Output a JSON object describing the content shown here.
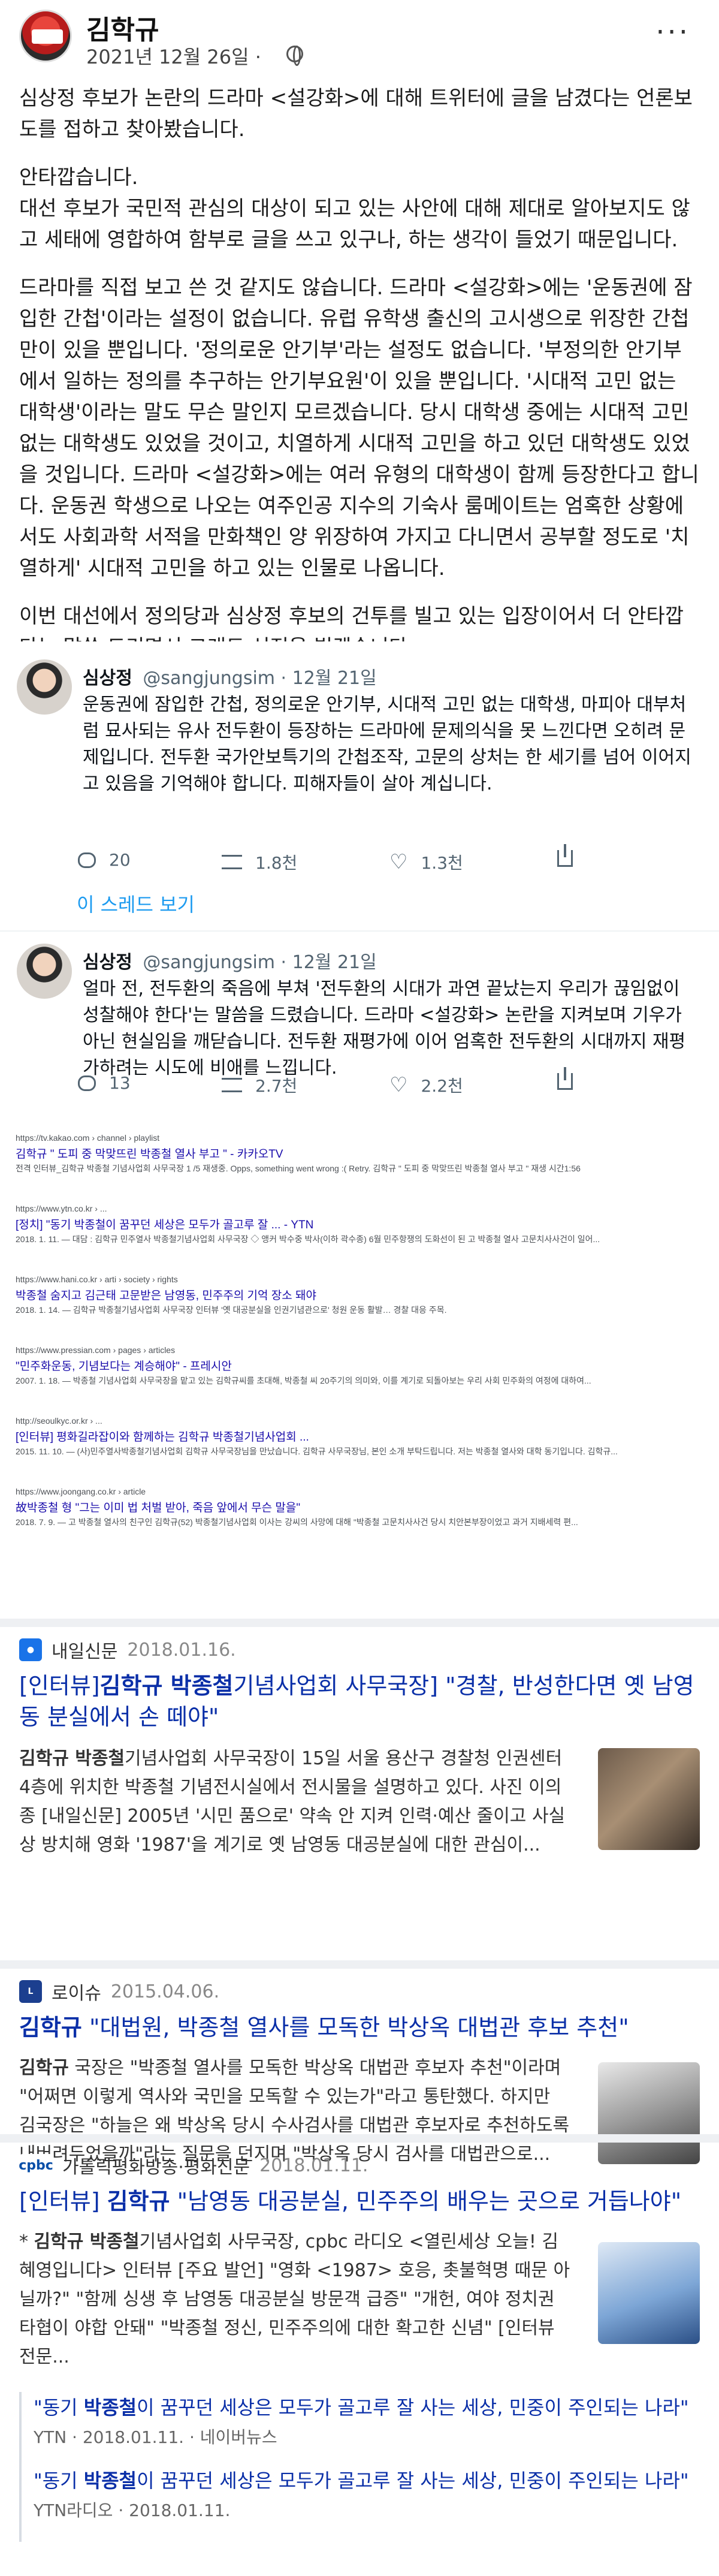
{
  "post": {
    "author": "김학규",
    "date": "2021년 12월 26일 ·",
    "paragraphs": [
      "심상정 후보가 논란의 드라마 <설강화>에 대해 트위터에 글을 남겼다는 언론보도를 접하고 찾아봤습니다.",
      "안타깝습니다.\n대선 후보가 국민적 관심의 대상이 되고 있는 사안에 대해 제대로 알아보지도 않고 세태에 영합하여 함부로 글을 쓰고 있구나, 하는 생각이 들었기 때문입니다.",
      "드라마를 직접 보고 쓴 것 같지도 않습니다. 드라마 <설강화>에는 '운동권에 잠입한 간첩'이라는 설정이 없습니다. 유럽 유학생 출신의 고시생으로 위장한 간첩만이 있을 뿐입니다. '정의로운 안기부'라는 설정도 없습니다. '부정의한 안기부에서 일하는 정의를 추구하는 안기부요원'이 있을 뿐입니다. '시대적 고민 없는 대학생'이라는 말도 무슨 말인지 모르겠습니다. 당시 대학생 중에는 시대적 고민 없는 대학생도 있었을 것이고, 치열하게 시대적 고민을 하고 있던 대학생도 있었을 것입니다. 드라마 <설강화>에는 여러 유형의 대학생이 함께 등장한다고 합니다. 운동권 학생으로 나오는 여주인공 지수의 기숙사 룸메이트는 엄혹한 상황에서도 사회과학 서적을 만화책인 양 위장하여 가지고 다니면서 공부할 정도로 '치열하게' 시대적 고민을 하고 있는 인물로 나옵니다.",
      "이번 대선에서 정의당과 심상정 후보의 건투를 빌고 있는 입장이어서 더 안타깝다는 말씀 드리면서 그래도 선전을 빌겠습니다."
    ]
  },
  "tweets": [
    {
      "name": "심상정",
      "handle": "@sangjungsim · 12월 21일",
      "text": "운동권에 잠입한 간첩, 정의로운 안기부, 시대적 고민 없는 대학생, 마피아 대부처럼 묘사되는 유사 전두환이 등장하는 드라마에 문제의식을 못 느낀다면 오히려 문제입니다. 전두환 국가안보특기의 간첩조작, 고문의 상처는 한 세기를 넘어 이어지고 있음을 기억해야 합니다. 피해자들이 살아 계십니다.",
      "replies": "20",
      "retweets": "1.8천",
      "likes": "1.3천"
    },
    {
      "name": "심상정",
      "handle": "@sangjungsim · 12월 21일",
      "text": "얼마 전, 전두환의 죽음에 부쳐 '전두환의 시대가 과연 끝났는지 우리가 끊임없이 성찰해야 한다'는 말씀을 드렸습니다. 드라마 <설강화> 논란을 지켜보며 기우가 아닌 현실임을 깨닫습니다. 전두환 재평가에 이어 엄혹한 전두환의 시대까지 재평가하려는 시도에 비애를 느낍니다.",
      "replies": "13",
      "retweets": "2.7천",
      "likes": "2.2천"
    }
  ],
  "thread_link": "이 스레드 보기",
  "google_results": [
    {
      "url": "https://tv.kakao.com › channel › playlist",
      "title": "김학규 \" 도피 중 막맞뜨린 박종철 열사 부고 \" - 카카오TV",
      "snippet": "전격 인터뷰_김학규 박종철 기념사업회 사무국장 1 /5 재생중. Opps, something went wrong :( Retry. 김학규 \" 도피 중 막맞뜨린 박종철 열사 부고 \" 재생 시간1:56"
    },
    {
      "url": "https://www.ytn.co.kr › ...",
      "title": "[정치] \"동기 박종철이 꿈꾸던 세상은 모두가 골고루 잘 ... - YTN",
      "snippet": "2018. 1. 11. — 대담 : 김학규 민주열사 박종철기념사업회 사무국장 ◇ 앵커 박수중 박사(이하 곽수종) 6월 민주항쟁의 도화선이 된 고 박종철 열사 고문치사사건이 일어..."
    },
    {
      "url": "https://www.hani.co.kr › arti › society › rights",
      "title": "박종철 숨지고 김근태 고문받은 남영동, 민주주의 기억 장소 돼야",
      "snippet": "2018. 1. 14. — 김학규 박종철기념사업회 사무국장 인터뷰 '옛 대공분실을 인권기념관으로' 청원 운동 활발… 경찰 대응 주목."
    },
    {
      "url": "https://www.pressian.com › pages › articles",
      "title": "\"민주화운동, 기념보다는 계승해야\" - 프레시안",
      "snippet": "2007. 1. 18. — 박종철 기념사업회 사무국장을 맡고 있는 김학규씨를 초대해, 박종철 씨 20주기의 의미와, 이를 계기로 되돌아보는 우리 사회 민주화의 여정에 대하여..."
    },
    {
      "url": "http://seoulkyc.or.kr › ...",
      "title": "[인터뷰] 평화길라잡이와 함께하는 김학규 박종철기념사업회 ...",
      "snippet": "2015. 11. 10. — (사)민주열사박종철기념사업회 김학규 사무국장님을 만났습니다. 김학규 사무국장님, 본인 소개 부탁드립니다. 저는 박종철 열사와 대학 동기입니다. 김학규..."
    },
    {
      "url": "https://www.joongang.co.kr › article",
      "title": "故박종철 형 \"그는 이미 법 처벌 받아, 죽음 앞에서 무슨 말을\"",
      "snippet": "2018. 7. 9. — 고 박종철 열사의 친구인 김학규(52) 박종철기념사업회 이사는 강씨의 사망에 대해 \"박종철 고문치사사건 당시 치안본부장이었고 과거 지배세력 편..."
    }
  ],
  "news": [
    {
      "source": "내일신문",
      "date": "2018.01.16.",
      "title_parts": [
        "[인터뷰]",
        "김학규 박종철",
        "기념사업회 사무국장] \"경찰, 반성한다면 옛 남영동 분실에서 손 떼야\""
      ],
      "snippet_parts": [
        "",
        "김학규 박종철",
        "기념사업회 사무국장이 15일 서울 용산구 경찰청 인권센터 4층에 위치한 박종철 기념전시실에서 전시물을 설명하고 있다. 사진 이의종 [내일신문] 2005년 '시민 품으로' 약속 안 지켜 인력·예산 줄이고 사실상 방치해 영화 '1987'을 계기로 옛 남영동 대공분실에 대한 관심이..."
      ]
    },
    {
      "source": "로이슈",
      "date": "2015.04.06.",
      "title_parts": [
        "",
        "김학규",
        " \"대법원, 박종철 열사를 모독한 박상옥 대법관 후보 추천\""
      ],
      "snippet_parts": [
        "",
        "김학규",
        " 국장은 \"박종철 열사를 모독한 박상옥 대법관 후보자 추천\"이라며 \"어쩌면 이렇게 역사와 국민을 모독할 수 있는가\"라고 통탄했다. 하지만 김국장은 \"하늘은 왜 박상옥 당시 수사검사를 대법관 후보자로 추천하도록 내버려두었을까\"라는 질문을 던지며 \"박상옥 당시 검사를 대법관으로..."
      ]
    },
    {
      "source": "가톨릭평화방송·평화신문",
      "date": "2018.01.11.",
      "title_parts": [
        "[인터뷰] ",
        "김학규",
        " \"남영동 대공분실, 민주주의 배우는 곳으로 거듭나야\""
      ],
      "snippet_parts": [
        "* ",
        "김학규 박종철",
        "기념사업회 사무국장, cpbc 라디오 <열린세상 오늘! 김혜영입니다> 인터뷰 [주요 발언] \"영화 <1987> 호응, 촛불혁명 때문 아닐까?\" \"함께 싱생 후 남영동 대공분실 방문객 급증\" \"개헌, 여야 정치권 타협이 야합 안돼\" \"박종철 정신, 민주주의에 대한 확고한 신념\" [인터뷰 전문..."
      ]
    }
  ],
  "related": [
    {
      "title_parts": [
        "\"동기 ",
        "박종철",
        "이 꿈꾸던 세상은 모두가 골고루 잘 사는 세상, 민중이 주인되는 나라\""
      ],
      "source": "YTN",
      "date": "2018.01.11.",
      "extra": "네이버뉴스"
    },
    {
      "title_parts": [
        "\"동기 ",
        "박종철",
        "이 꿈꾸던 세상은 모두가 골고루 잘 사는 세상, 민중이 주인되는 나라\""
      ],
      "source": "YTN라디오",
      "date": "2018.01.11.",
      "extra": ""
    }
  ]
}
